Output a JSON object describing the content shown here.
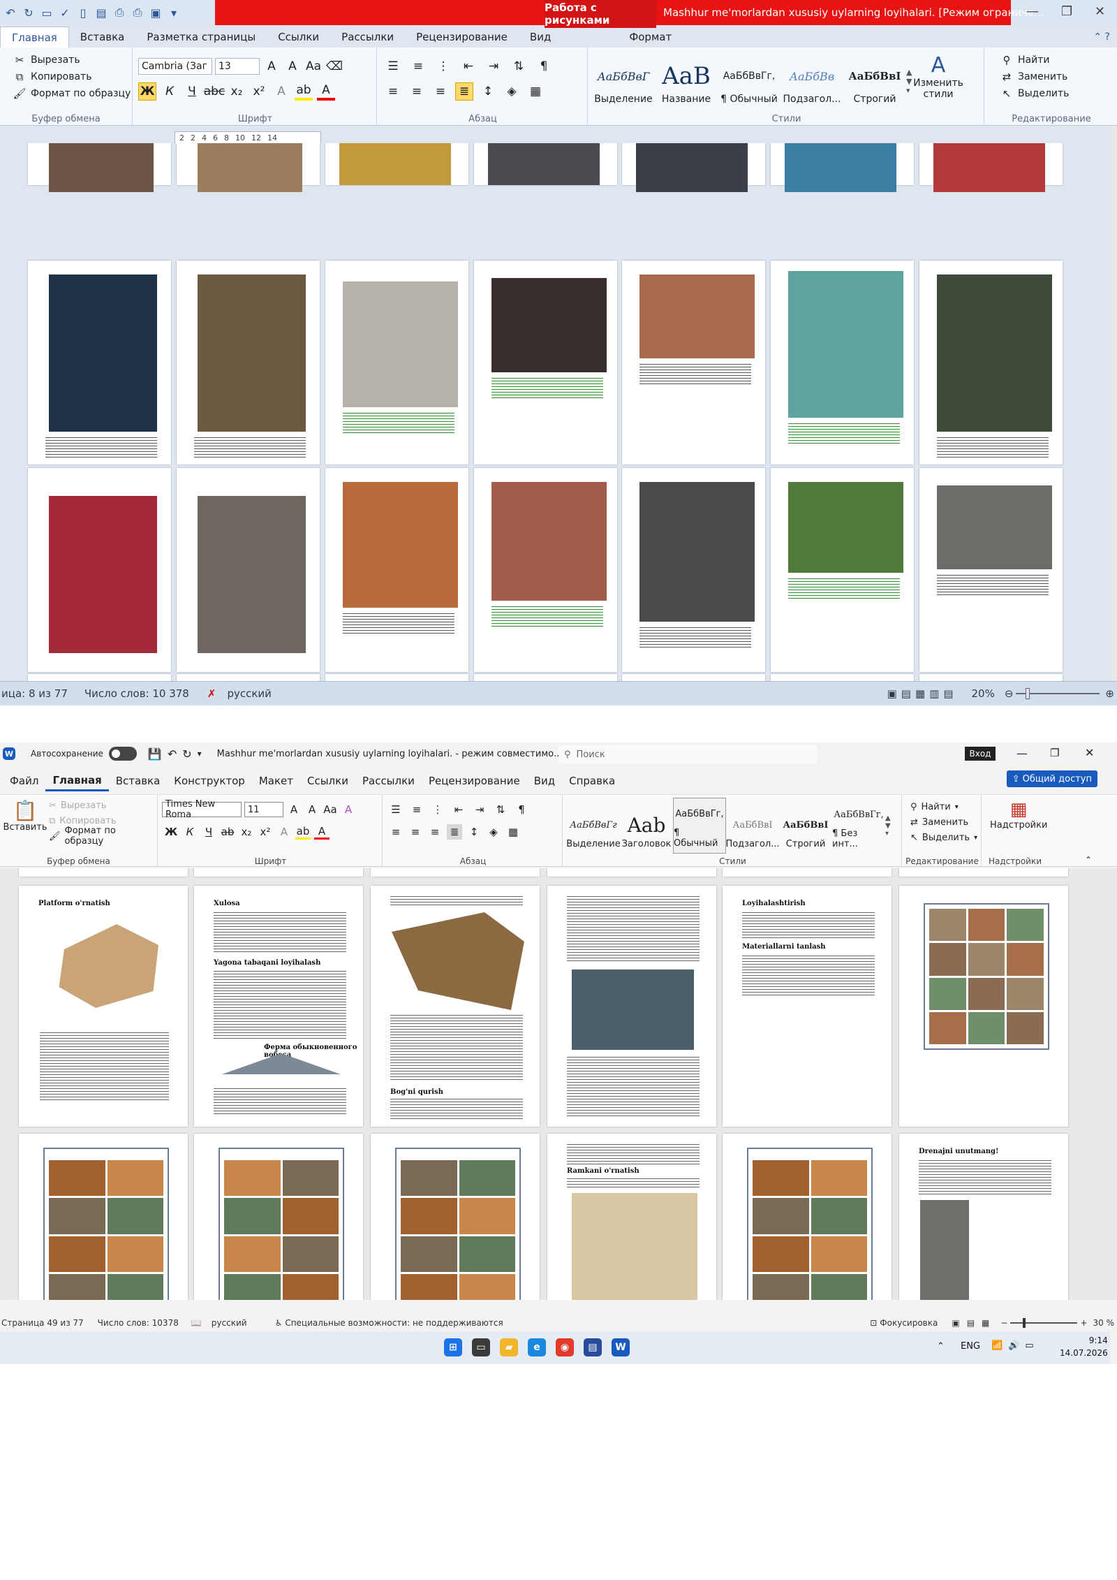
{
  "old_window": {
    "context_tab": "Работа с рисунками",
    "doc_title": "Mashhur me'morlardan xususiy uylarning loyihalari. [Режим ограниче...",
    "tabs": [
      "Главная",
      "Вставка",
      "Разметка страницы",
      "Ссылки",
      "Рассылки",
      "Рецензирование",
      "Вид",
      "Формат"
    ],
    "clipboard": {
      "cut": "Вырезать",
      "copy": "Копировать",
      "format_painter": "Формат по образцу",
      "label": "Буфер обмена"
    },
    "font": {
      "name": "Cambria (Заг",
      "size": "13",
      "label": "Шрифт"
    },
    "paragraph_label": "Абзац",
    "styles": [
      {
        "preview": "АаБбВвГ",
        "name": "Выделение"
      },
      {
        "preview": "AaB",
        "name": "Название"
      },
      {
        "preview": "АаБбВвГг,",
        "name": "¶ Обычный"
      },
      {
        "preview": "АаБбВв",
        "name": "Подзагол..."
      },
      {
        "preview": "АаБбВвІ",
        "name": "Строгий"
      }
    ],
    "change_styles": "Изменить стили",
    "styles_label": "Стили",
    "editing": {
      "find": "Найти",
      "replace": "Заменить",
      "select": "Выделить",
      "label": "Редактирование"
    },
    "ruler_ticks": [
      "2",
      "2",
      "4",
      "6",
      "8",
      "10",
      "12",
      "14"
    ],
    "status": {
      "page": "ица: 8 из 77",
      "words": "Число слов: 10 378",
      "lang": "русский",
      "zoom": "20%"
    }
  },
  "new_window": {
    "autosave": "Автосохранение",
    "doc_title": "Mashhur me'morlardan xususiy uylarning loyihalari. - режим совместимо...",
    "search_placeholder": "Поиск",
    "login": "Вход",
    "tabs": [
      "Файл",
      "Главная",
      "Вставка",
      "Конструктор",
      "Макет",
      "Ссылки",
      "Рассылки",
      "Рецензирование",
      "Вид",
      "Справка"
    ],
    "share": "Общий доступ",
    "clipboard": {
      "paste": "Вставить",
      "cut": "Вырезать",
      "copy": "Копировать",
      "format_painter": "Формат по образцу",
      "label": "Буфер обмена"
    },
    "font": {
      "name": "Times New Roma",
      "size": "11",
      "label": "Шрифт"
    },
    "paragraph_label": "Абзац",
    "styles": [
      {
        "preview": "АаБбВвГг",
        "name": "Выделение"
      },
      {
        "preview": "Aab",
        "name": "Заголовок"
      },
      {
        "preview": "АаБбВвГг,",
        "name": "¶ Обычный"
      },
      {
        "preview": "АаБбВвІ",
        "name": "Подзагол..."
      },
      {
        "preview": "АаБбВвІ",
        "name": "Строгий"
      },
      {
        "preview": "АаБбВвГг,",
        "name": "¶ Без инт..."
      }
    ],
    "styles_label": "Стили",
    "editing": {
      "find": "Найти",
      "replace": "Заменить",
      "select": "Выделить",
      "label": "Редактирование"
    },
    "addins": {
      "btn": "Надстройки",
      "label": "Надстройки"
    },
    "page_headings": {
      "p1": "Platform o'rnatish",
      "p2a": "Xulosa",
      "p2b": "Yagona tabaqani loyihalash",
      "p2c": "Ферма обыкновенного вобеса",
      "p3": "Bog'ni qurish",
      "p5a": "Loyihalashtirish",
      "p5b": "Materiallarni tanlash",
      "p10": "Ramkani o'rnatish",
      "p12": "Drenajni unutmang!"
    },
    "status": {
      "page": "Страница 49 из 77",
      "words": "Число слов: 10378",
      "lang": "русский",
      "accessibility": "Специальные возможности: не поддерживаются",
      "focus": "Фокусировка",
      "zoom": "30 %"
    },
    "taskbar": {
      "lang": "ENG",
      "time": "9:14",
      "date": "14.07.2026"
    }
  }
}
